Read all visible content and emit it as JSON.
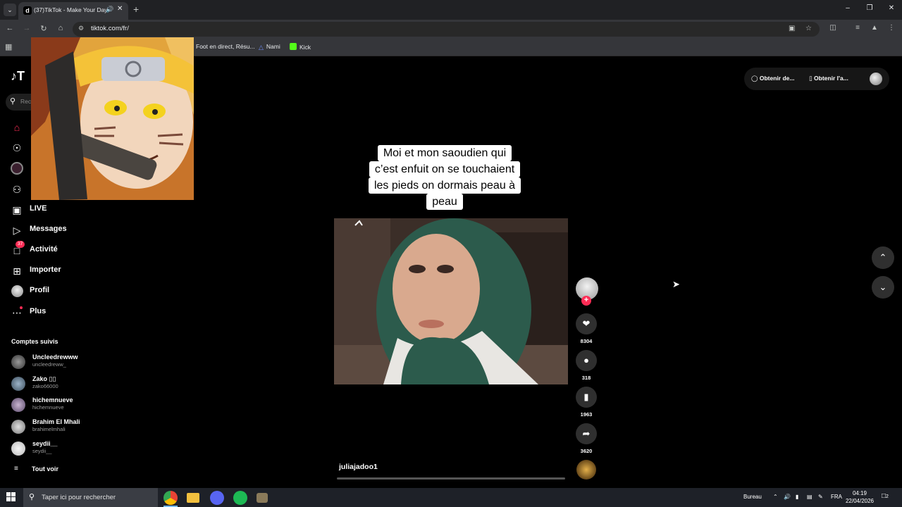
{
  "browser": {
    "tab_title": "(37)TikTok - Make Your Day",
    "tab_favicon": "d",
    "url": "tiktok.com/fr/",
    "bookmarks": [
      {
        "label": "Foot en direct, Résu...",
        "color": "#d9d9d9"
      },
      {
        "label": "Nami",
        "color": "#6e8cf7"
      },
      {
        "label": "Kick",
        "color": "#53fc18"
      }
    ]
  },
  "tiktok": {
    "logo": "T",
    "search_placeholder": "Rec",
    "nav": [
      {
        "label": "LIVE",
        "icon": "live-icon"
      },
      {
        "label": "Messages",
        "icon": "messages-icon"
      },
      {
        "label": "Activité",
        "icon": "activity-icon",
        "badge": "37"
      },
      {
        "label": "Importer",
        "icon": "upload-icon"
      },
      {
        "label": "Profil",
        "icon": "profile-icon"
      },
      {
        "label": "Plus",
        "icon": "more-icon"
      }
    ],
    "following_title": "Comptes suivis",
    "following": [
      {
        "name": "Uncleedrewww",
        "handle": "uncleedreww_"
      },
      {
        "name": "Zako ▯▯",
        "handle": "zako66000"
      },
      {
        "name": "hichemnueve",
        "handle": "hichemnueve"
      },
      {
        "name": "Brahim El Mhali",
        "handle": "brahimelmhali"
      },
      {
        "name": "seydii__",
        "handle": "seydii__"
      }
    ],
    "see_all": "Tout voir",
    "top_right": {
      "coins": "Obtenir de...",
      "app": "Obtenir l'a..."
    },
    "video": {
      "caption_lines": [
        "Moi et mon saoudien qui",
        "c’est enfuit on se touchaient",
        "les pieds on dormais peau à",
        "peau"
      ],
      "author": "juliajadoo1",
      "likes": "8304",
      "comments": "318",
      "saves": "1963",
      "shares": "3620"
    }
  },
  "taskbar": {
    "search_text": "Taper ici pour rechercher",
    "desktop_label": "Bureau",
    "language": "FRA",
    "time": "04:19",
    "date": "22/04/2026",
    "notifications": "2"
  }
}
